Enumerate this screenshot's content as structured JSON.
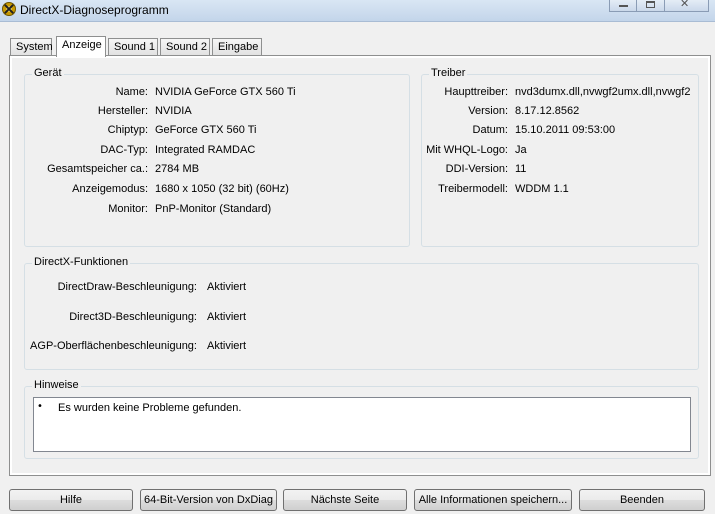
{
  "window": {
    "title": "DirectX-Diagnoseprogramm",
    "controls": {
      "close_glyph": "✕"
    }
  },
  "tabs": [
    {
      "label": "System",
      "active": false
    },
    {
      "label": "Anzeige",
      "active": true
    },
    {
      "label": "Sound 1",
      "active": false
    },
    {
      "label": "Sound 2",
      "active": false
    },
    {
      "label": "Eingabe",
      "active": false
    }
  ],
  "device": {
    "group_label": "Gerät",
    "rows": [
      {
        "label": "Name:",
        "value": "NVIDIA GeForce GTX 560 Ti"
      },
      {
        "label": "Hersteller:",
        "value": "NVIDIA"
      },
      {
        "label": "Chiptyp:",
        "value": "GeForce GTX 560 Ti"
      },
      {
        "label": "DAC-Typ:",
        "value": "Integrated RAMDAC"
      },
      {
        "label": "Gesamtspeicher ca.:",
        "value": "2784 MB"
      },
      {
        "label": "Anzeigemodus:",
        "value": "1680 x 1050 (32 bit) (60Hz)"
      },
      {
        "label": "Monitor:",
        "value": "PnP-Monitor (Standard)"
      }
    ]
  },
  "driver": {
    "group_label": "Treiber",
    "rows": [
      {
        "label": "Haupttreiber:",
        "value": "nvd3dumx.dll,nvwgf2umx.dll,nvwgf2"
      },
      {
        "label": "Version:",
        "value": "8.17.12.8562"
      },
      {
        "label": "Datum:",
        "value": "15.10.2011 09:53:00"
      },
      {
        "label": "Mit WHQL-Logo:",
        "value": "Ja"
      },
      {
        "label": "DDI-Version:",
        "value": "11"
      },
      {
        "label": "Treibermodell:",
        "value": "WDDM 1.1"
      }
    ]
  },
  "directx": {
    "group_label": "DirectX-Funktionen",
    "rows": [
      {
        "label": "DirectDraw-Beschleunigung:",
        "value": "Aktiviert"
      },
      {
        "label": "Direct3D-Beschleunigung:",
        "value": "Aktiviert"
      },
      {
        "label": "AGP-Oberflächenbeschleunigung:",
        "value": "Aktiviert"
      }
    ]
  },
  "notes": {
    "group_label": "Hinweise",
    "bullet": "•",
    "items": [
      "Es wurden keine Probleme gefunden."
    ]
  },
  "buttons": {
    "help": "Hilfe",
    "bit64": "64-Bit-Version von DxDiag",
    "next_page": "Nächste Seite",
    "save_all": "Alle Informationen speichern...",
    "exit": "Beenden"
  }
}
